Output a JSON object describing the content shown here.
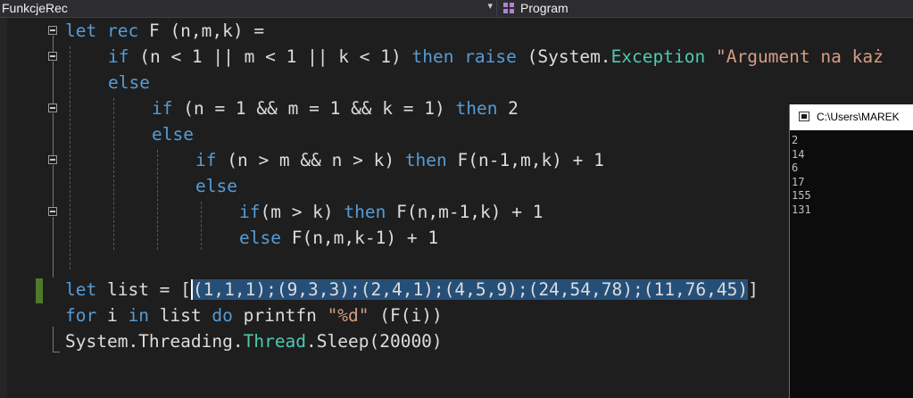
{
  "nav": {
    "left_label": "FunkcjeRec",
    "dropdown_glyph": "▾",
    "right_label": "Program",
    "right_icon": "class-icon"
  },
  "code": {
    "l1": {
      "t1": "let",
      "t2": " ",
      "t3": "rec",
      "t4": " F (n,m,k) ="
    },
    "l2": {
      "t1": "if",
      "t2": " (n < 1 || m < 1 || k < 1) ",
      "t3": "then",
      "t4": " ",
      "t5": "raise",
      "t6": " (System.",
      "t7": "Exception",
      "t8": " ",
      "t9": "\"Argument na każ"
    },
    "l3": {
      "t1": "else"
    },
    "l4": {
      "t1": "if",
      "t2": " (n = 1 && m = 1 && k = 1) ",
      "t3": "then",
      "t4": " 2"
    },
    "l5": {
      "t1": "else"
    },
    "l6": {
      "t1": "if",
      "t2": " (n > m && n > k) ",
      "t3": "then",
      "t4": " F(n-1,m,k) + 1"
    },
    "l7": {
      "t1": "else"
    },
    "l8": {
      "t1": "if",
      "t2": "(m > k) ",
      "t3": "then",
      "t4": " F(n,m-1,k) + 1"
    },
    "l9": {
      "t1": "else",
      "t2": " F(n,m,k-1) + 1"
    },
    "l11": {
      "t1": "let",
      "t2": " list = [",
      "t3": "(1,1,1);(9,3,3);(2,4,1);(4,5,9);(24,54,78);(11,76,45)",
      "t4": "]"
    },
    "l12": {
      "t1": "for",
      "t2": " i ",
      "t3": "in",
      "t4": " list ",
      "t5": "do",
      "t6": " printfn ",
      "t7": "\"%d\"",
      "t8": " (F(i))"
    },
    "l13": {
      "t1": "System.Threading.",
      "t2": "Thread",
      "t3": ".Sleep(20000)"
    }
  },
  "console": {
    "title": "C:\\Users\\MAREK",
    "output": [
      "2",
      "14",
      "6",
      "17",
      "155",
      "131"
    ]
  },
  "colors": {
    "background": "#1e1e1e",
    "keyword": "#569cd6",
    "type": "#4ec9b0",
    "string": "#d69d85",
    "selection": "#264f78",
    "change_marker": "#4f7a28"
  }
}
